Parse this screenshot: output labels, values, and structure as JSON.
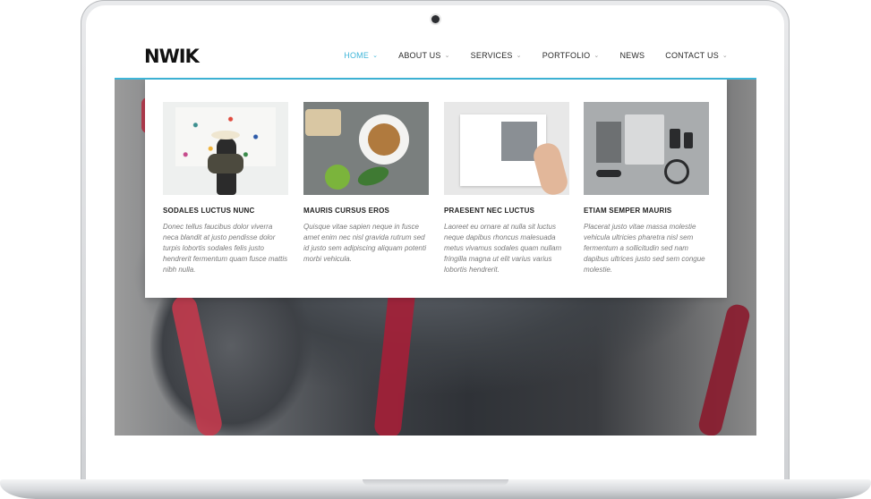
{
  "site": {
    "logo": "NWIK"
  },
  "nav": [
    {
      "label": "HOME",
      "has_dropdown": true,
      "active": true
    },
    {
      "label": "ABOUT US",
      "has_dropdown": true,
      "active": false
    },
    {
      "label": "SERVICES",
      "has_dropdown": true,
      "active": false
    },
    {
      "label": "PORTFOLIO",
      "has_dropdown": true,
      "active": false
    },
    {
      "label": "NEWS",
      "has_dropdown": false,
      "active": false
    },
    {
      "label": "CONTACT US",
      "has_dropdown": true,
      "active": false
    }
  ],
  "chevron_glyph": "⌄",
  "mega_menu": [
    {
      "title": "SODALES LUCTUS NUNC",
      "text": "Donec tellus faucibus dolor viverra neca blandit at justo pendisse dolor turpis lobortis sodales felis justo hendrerit fermentum quam fusce mattis nibh nulla."
    },
    {
      "title": "MAURIS CURSUS EROS",
      "text": "Quisque vitae sapien neque in fusce amet enim nec nisl gravida rutrum sed id justo sem adipiscing aliquam potenti morbi vehicula."
    },
    {
      "title": "PRAESENT NEC LUCTUS",
      "text": "Laoreet eu ornare at nulla sit luctus neque dapibus rhoncus malesuada metus vivamus sodales quam nullam fringilla magna ut elit varius varius lobortis hendrerit."
    },
    {
      "title": "ETIAM SEMPER MAURIS",
      "text": "Placerat justo vitae massa molestie vehicula ultricies pharetra nisl sem fermentum a sollicitudin sed nam dapibus ultrices justo sed sem congue molestie."
    }
  ],
  "colors": {
    "accent": "#3fb6d9",
    "text": "#2a2a2a",
    "muted": "#7a7a7a"
  }
}
